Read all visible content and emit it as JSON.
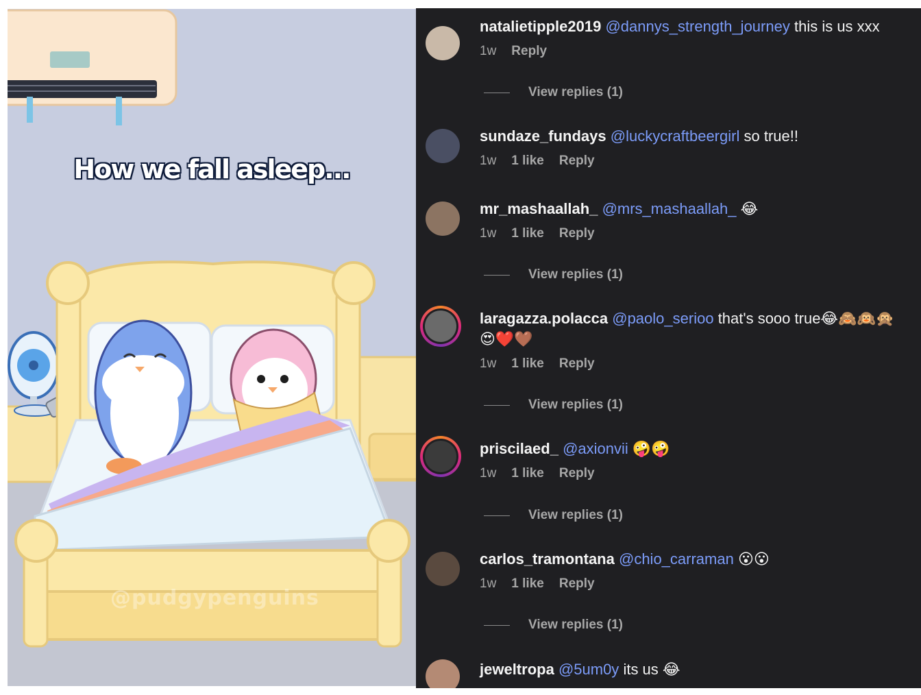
{
  "video": {
    "caption": "How we fall asleep...",
    "watermark": "@pudgypenguins"
  },
  "comments": [
    {
      "username": "natalietipple2019",
      "mention": "@dannys_strength_journey",
      "text": "this is us xxx",
      "time": "1w",
      "likes": "",
      "reply_label": "Reply",
      "view_replies": "View replies (1)",
      "avatar_color": "#c9b9a8",
      "story_ring": false
    },
    {
      "username": "sundaze_fundays",
      "mention": "@luckycraftbeergirl",
      "text": "so true!!",
      "time": "1w",
      "likes": "1 like",
      "reply_label": "Reply",
      "view_replies": "",
      "avatar_color": "#4a4f63",
      "story_ring": false
    },
    {
      "username": "mr_mashaallah_",
      "mention": "@mrs_mashaallah_",
      "text": "😂",
      "time": "1w",
      "likes": "1 like",
      "reply_label": "Reply",
      "view_replies": "View replies (1)",
      "avatar_color": "#8c7462",
      "story_ring": false
    },
    {
      "username": "laragazza.polacca",
      "mention": "@paolo_serioo",
      "text": "that's sooo true😂🙈🙉🙊",
      "text2": "😍❤️🤎",
      "time": "1w",
      "likes": "1 like",
      "reply_label": "Reply",
      "view_replies": "View replies (1)",
      "avatar_color": "#6a6a6a",
      "story_ring": true
    },
    {
      "username": "priscilaed_",
      "mention": "@axionvii",
      "text": "🤪🤪",
      "time": "1w",
      "likes": "1 like",
      "reply_label": "Reply",
      "view_replies": "View replies (1)",
      "avatar_color": "#3b3b3b",
      "story_ring": true
    },
    {
      "username": "carlos_tramontana",
      "mention": "@chio_carraman",
      "text": "😮😮",
      "time": "1w",
      "likes": "1 like",
      "reply_label": "Reply",
      "view_replies": "View replies (1)",
      "avatar_color": "#5a4a3f",
      "story_ring": false
    },
    {
      "username": "jeweltropa",
      "mention": "@5um0y",
      "text": "its us 😂",
      "time": "",
      "likes": "",
      "reply_label": "",
      "view_replies": "",
      "avatar_color": "#b48a74",
      "story_ring": false
    }
  ]
}
